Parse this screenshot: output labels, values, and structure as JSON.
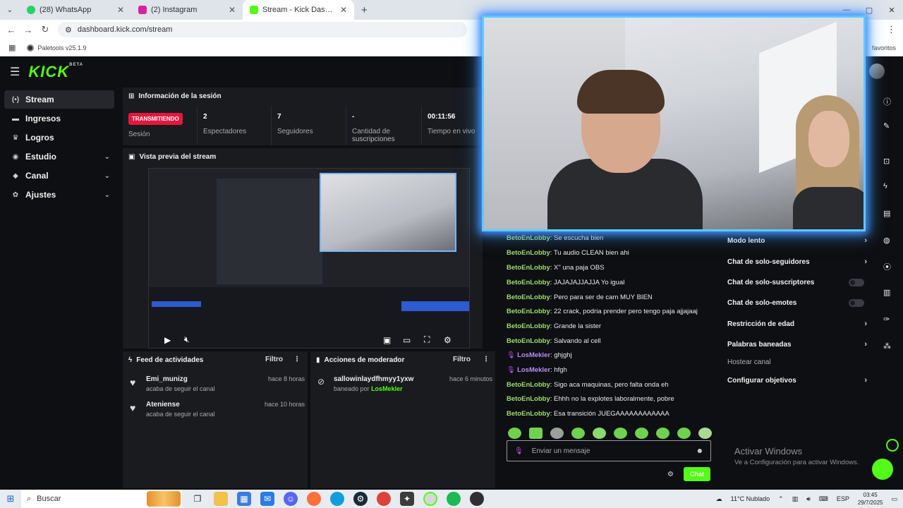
{
  "browser": {
    "tabs": [
      {
        "label": "(28) WhatsApp",
        "color": "#25d366"
      },
      {
        "label": "(2) Instagram",
        "color": "#d6249f"
      },
      {
        "label": "Stream - Kick Dashboard",
        "color": "#53fc18"
      }
    ],
    "url": "dashboard.kick.com/stream",
    "bookmark": "Paletools v25.1.9",
    "favorites": "favoritos"
  },
  "app": {
    "logo": "KICK",
    "logo_badge": "BETA",
    "accent": "#53fc18"
  },
  "sidebar": {
    "items": [
      {
        "label": "Stream",
        "icon": "broadcast-icon",
        "glyph": "(•)"
      },
      {
        "label": "Ingresos",
        "icon": "money-icon",
        "glyph": "▬"
      },
      {
        "label": "Logros",
        "icon": "trophy-icon",
        "glyph": "♛"
      },
      {
        "label": "Estudio",
        "icon": "studio-icon",
        "glyph": "◉"
      },
      {
        "label": "Canal",
        "icon": "channel-icon",
        "glyph": "◆"
      },
      {
        "label": "Ajustes",
        "icon": "gear-icon",
        "glyph": "✿"
      }
    ]
  },
  "session": {
    "title": "Información de la sesión",
    "live_label": "TRANSMITIENDO",
    "session_label": "Sesión",
    "viewers_value": "2",
    "viewers_label": "Espectadores",
    "followers_value": "7",
    "followers_label": "Seguidores",
    "subs_value": "-",
    "subs_label_1": "Cantidad de",
    "subs_label_2": "suscripciones",
    "time_value": "00:11:56",
    "time_label": "Tiempo en vivo"
  },
  "preview": {
    "title": "Vista previa del stream"
  },
  "feed": {
    "title": "Feed de actividades",
    "filter": "Filtro",
    "items": [
      {
        "name": "Emi_munizg",
        "text": "acaba de seguir el canal",
        "time": "hace 8 horas"
      },
      {
        "name": "Ateniense",
        "text": "acaba de seguir el canal",
        "time": "hace 10 horas"
      }
    ]
  },
  "mod": {
    "title": "Acciones de moderador",
    "filter": "Filtro",
    "items": [
      {
        "name": "sallowinlaydfhmyy1yxw",
        "text": "baneado por",
        "by": "LosMekler",
        "time": "hace 6 minutos"
      }
    ]
  },
  "chat": {
    "messages": [
      {
        "user": "BetoEnLobby",
        "text": ": Se escucha bien"
      },
      {
        "user": "BetoEnLobby",
        "text": ": Tu audio CLEAN bien ahi"
      },
      {
        "user": "BetoEnLobby",
        "text": ": X\" una paja OBS"
      },
      {
        "user": "BetoEnLobby",
        "text": ": JAJAJAJJAJJA Yo igual"
      },
      {
        "user": "BetoEnLobby",
        "text": ": Pero para ser de cam MUY BIEN"
      },
      {
        "user": "BetoEnLobby",
        "text": ": 22 crack, podria prender pero tengo paja ajjajaaj"
      },
      {
        "user": "BetoEnLobby",
        "text": ": Grande la sister"
      },
      {
        "user": "BetoEnLobby",
        "text": ": Salvando al cell"
      },
      {
        "user": "LosMekler",
        "text": ": ghjghj"
      },
      {
        "user": "LosMekler",
        "text": ": hfgh"
      },
      {
        "user": "BetoEnLobby",
        "text": ": Sigo aca maquinas, pero falta onda eh"
      },
      {
        "user": "BetoEnLobby",
        "text": ": Ehhh no la explotes laboralmente, pobre"
      },
      {
        "user": "BetoEnLobby",
        "text": ": Esa transición JUEGAAAAAAAAAAAA"
      }
    ],
    "placeholder": "Enviar un mensaje",
    "send": "Chat"
  },
  "chat_settings": {
    "slow": "Modo lento",
    "followers_only": "Chat de solo-seguidores",
    "subs_only": "Chat de solo-suscriptores",
    "emotes_only": "Chat de solo-emotes",
    "age": "Restricción de edad",
    "banned_words": "Palabras baneadas",
    "host": "Hostear canal",
    "goals": "Configurar objetivos"
  },
  "watermark": {
    "line1": "Activar Windows",
    "line2": "Ve a Configuración para activar Windows."
  },
  "taskbar": {
    "search": "Buscar",
    "weather": "11°C Nublado",
    "lang": "ESP",
    "time": "03:45",
    "date": "29/7/2025"
  }
}
